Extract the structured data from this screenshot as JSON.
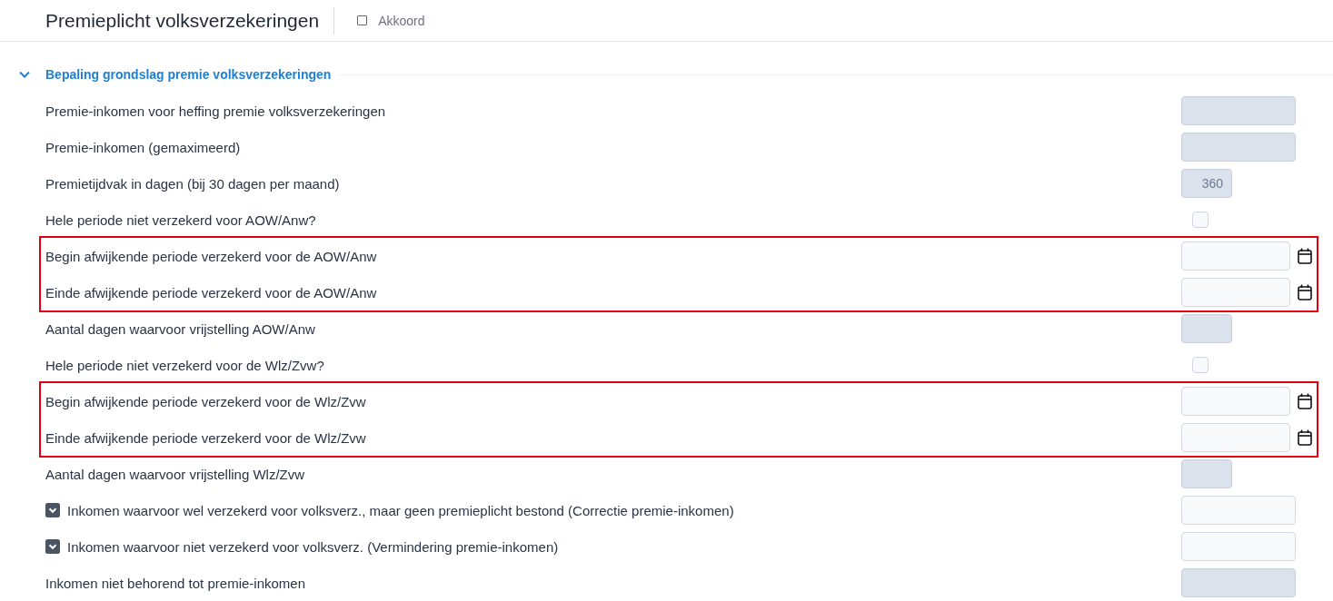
{
  "header": {
    "title": "Premieplicht volksverzekeringen",
    "approval": {
      "label": "Akkoord",
      "checked": false
    }
  },
  "section": {
    "title": "Bepaling grondslag premie volksverzekeringen",
    "expanded": true,
    "blocks": [
      {
        "highlighted": false,
        "rows": [
          {
            "label": "Premie-inkomen voor heffing premie volksverzekeringen",
            "input": {
              "kind": "amount",
              "disabled": true
            }
          },
          {
            "label": "Premie-inkomen (gemaximeerd)",
            "input": {
              "kind": "amount",
              "disabled": true
            }
          },
          {
            "label": "Premietijdvak in dagen (bij 30 dagen per maand)",
            "input": {
              "kind": "number",
              "disabled": true,
              "value": "360"
            }
          },
          {
            "label": "Hele periode niet verzekerd voor AOW/Anw?",
            "input": {
              "kind": "checkbox",
              "checked": false
            }
          }
        ]
      },
      {
        "highlighted": true,
        "rows": [
          {
            "label": "Begin afwijkende periode verzekerd voor de AOW/Anw",
            "input": {
              "kind": "date",
              "disabled": false
            }
          },
          {
            "label": "Einde afwijkende periode verzekerd voor de AOW/Anw",
            "input": {
              "kind": "date",
              "disabled": false
            }
          }
        ]
      },
      {
        "highlighted": false,
        "rows": [
          {
            "label": "Aantal dagen waarvoor vrijstelling AOW/Anw",
            "input": {
              "kind": "number",
              "disabled": true
            }
          },
          {
            "label": "Hele periode niet verzekerd voor de Wlz/Zvw?",
            "input": {
              "kind": "checkbox",
              "checked": false
            }
          }
        ]
      },
      {
        "highlighted": true,
        "rows": [
          {
            "label": "Begin afwijkende periode verzekerd voor de Wlz/Zvw",
            "input": {
              "kind": "date",
              "disabled": false
            }
          },
          {
            "label": "Einde afwijkende periode verzekerd voor de Wlz/Zvw",
            "input": {
              "kind": "date",
              "disabled": false
            }
          }
        ]
      },
      {
        "highlighted": false,
        "rows": [
          {
            "label": "Aantal dagen waarvoor vrijstelling Wlz/Zvw",
            "input": {
              "kind": "number",
              "disabled": true
            }
          },
          {
            "label": "Inkomen waarvoor wel verzekerd voor volksverz., maar geen premieplicht bestond (Correctie premie-inkomen)",
            "toggle": {
              "expanded": false
            },
            "input": {
              "kind": "amount",
              "disabled": false
            }
          },
          {
            "label": "Inkomen waarvoor niet verzekerd voor volksverz. (Vermindering premie-inkomen)",
            "toggle": {
              "expanded": false
            },
            "input": {
              "kind": "amount",
              "disabled": false
            }
          },
          {
            "label": "Inkomen niet behorend tot premie-inkomen",
            "input": {
              "kind": "amount",
              "disabled": true
            }
          }
        ]
      }
    ]
  }
}
